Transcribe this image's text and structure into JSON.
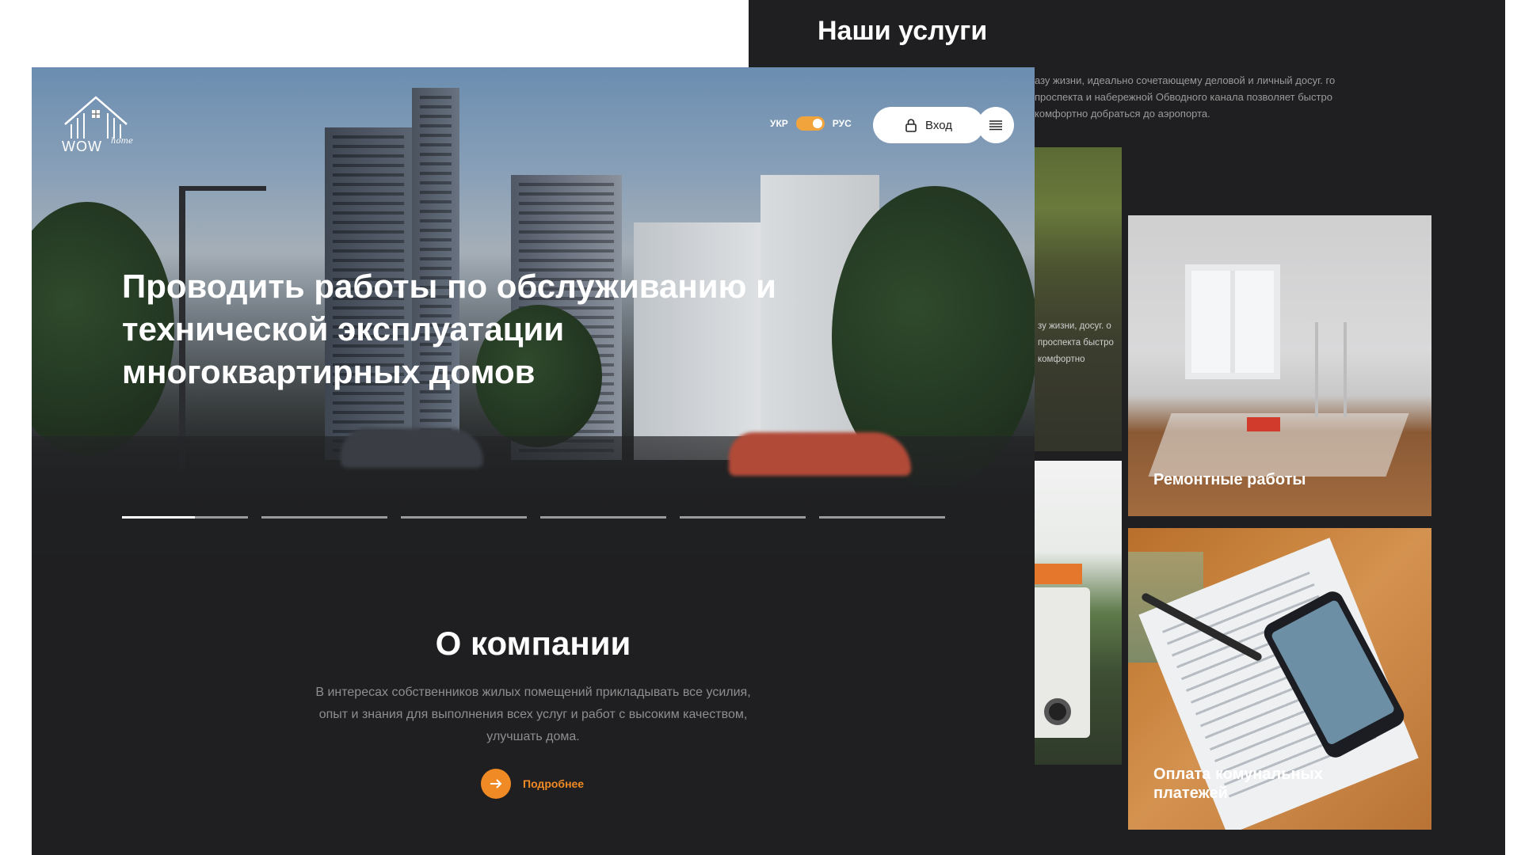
{
  "services": {
    "title": "Наши услуги",
    "description": "азу жизни, идеально сочетающему деловой и личный досуг. го проспекта и набережной Обводного канала позволяет быстро комфортно добраться до аэропорта.",
    "side_card_text": "зу жизни, досуг. о проспекта быстро комфортно",
    "cards": [
      {
        "label": "Ремонтные работы"
      },
      {
        "label": "Оплата комунальных платежей"
      }
    ]
  },
  "header": {
    "logo_text": "WOW",
    "logo_script": "home",
    "lang_left": "УКР",
    "lang_right": "РУС",
    "login_label": "Вход"
  },
  "hero": {
    "title": "Проводить работы по обслуживанию и технической эксплуатации многоквартирных домов",
    "slides_total": 6,
    "active_slide": 1
  },
  "about": {
    "title": "О компании",
    "text": "В интересах собственников жилых помещений прикладывать все усилия, опыт и знания для выполнения всех услуг и работ с высоким качеством, улучшать дома.",
    "more_label": "Подробнее"
  },
  "colors": {
    "accent": "#f08a24",
    "panel_bg": "#1f1f21"
  }
}
